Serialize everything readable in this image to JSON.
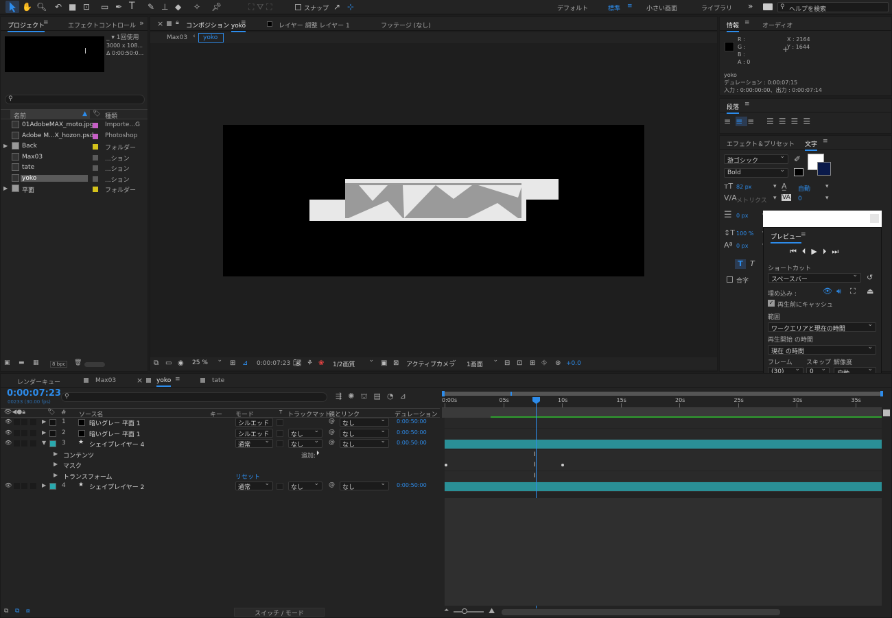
{
  "toolbar": {
    "snap_label": "スナップ",
    "workspaces": [
      "デフォルト",
      "標準",
      "小さい画面",
      "ライブラリ"
    ],
    "active_workspace": "標準",
    "search_placeholder": "ヘルプを検索"
  },
  "project": {
    "tab_project": "プロジェクト",
    "tab_effect_controls": "エフェクトコントロール",
    "thumb_info": [
      "1回使用",
      "3000 x 108...",
      "Δ 0:00:50:0..."
    ],
    "col_name": "名前",
    "col_type": "種類",
    "search_placeholder": "",
    "items": [
      {
        "name": "01AdobeMAX_moto.jpg",
        "type": "Importe...G",
        "color": "#c65fc6",
        "icon": "image-file-icon"
      },
      {
        "name": "Adobe M...X_hozon.psd",
        "type": "Photoshop",
        "color": "#c65fc6",
        "icon": "psd-file-icon"
      },
      {
        "name": "Back",
        "type": "フォルダー",
        "color": "#d4c21b",
        "icon": "folder-icon"
      },
      {
        "name": "Max03",
        "type": "...ション",
        "color": "#5a5a5a",
        "icon": "composition-icon"
      },
      {
        "name": "tate",
        "type": "...ション",
        "color": "#5a5a5a",
        "icon": "composition-icon"
      },
      {
        "name": "yoko",
        "type": "...ション",
        "color": "#5a5a5a",
        "icon": "composition-icon",
        "selected": true
      },
      {
        "name": "平面",
        "type": "フォルダー",
        "color": "#d4c21b",
        "icon": "folder-icon"
      }
    ],
    "bpc": "8 bpc"
  },
  "viewer": {
    "tab_comp_prefix": "コンポジション",
    "tab_comp_name": "yoko",
    "tab_layer": "レイヤー 調整 レイヤー 1",
    "tab_footage": "フッテージ (なし)",
    "breadcrumbs": [
      "Max03",
      "yoko"
    ],
    "zoom": "25 %",
    "timecode": "0:00:07:23",
    "resolution": "1/2画質",
    "camera": "アクティブカメラ",
    "views": "1画面",
    "exposure": "+0.0"
  },
  "info": {
    "tab_info": "情報",
    "tab_audio": "オーディオ",
    "rgba": [
      "R :",
      "G :",
      "B :",
      "A :  0"
    ],
    "x": "X : 2164",
    "y": "Y : 1644",
    "layer": "yoko",
    "duration": "デュレーション : 0:00:07:15",
    "inout": "入力 : 0:00:00:00、出力 : 0:00:07:14"
  },
  "paragraph": {
    "tab": "段落"
  },
  "character": {
    "tab_effects": "エフェクト＆プリセット",
    "tab_char": "文字",
    "font": "游ゴシック",
    "style": "Bold",
    "size": "82 px",
    "leading": "自動",
    "kerning": "メトリクス",
    "tracking": "0",
    "stroke": "0 px",
    "vscale": "100 %",
    "baseline": "0 px",
    "ligature": "合字"
  },
  "preview": {
    "title": "プレビュー",
    "shortcut_label": "ショートカット",
    "shortcut": "スペースバー",
    "embed_label": "埋め込み :",
    "cache_label": "再生前にキャッシュ",
    "range_label": "範囲",
    "range": "ワークエリアと現在の時間",
    "start_label": "再生開始 の時間",
    "start": "現在 の時間",
    "frame_label": "フレーム",
    "skip_label": "スキップ",
    "res_label": "解像度",
    "frame": "(30)",
    "skip": "0",
    "res": "自動"
  },
  "timeline": {
    "tabs": [
      "レンダーキュー",
      "Max03",
      "yoko",
      "tate"
    ],
    "active_tab": "yoko",
    "timecode": "0:00:07:23",
    "fps": "00233 (30.00 fps)",
    "cols": {
      "num": "#",
      "source": "ソース名",
      "key": "キー",
      "mode": "モード",
      "t": "T",
      "trkmat": "トラックマット",
      "parent": "親とリンク",
      "duration": "デュレーション"
    },
    "ruler": [
      "0:00s",
      "05s",
      "10s",
      "15s",
      "20s",
      "25s",
      "30s",
      "35s"
    ],
    "layers": [
      {
        "num": "1",
        "name": "暗いグレー 平面 1",
        "mode": "シルエット",
        "trkmat": "",
        "parent": "なし",
        "dur": "0:00:50:00",
        "color": "#111"
      },
      {
        "num": "2",
        "name": "暗いグレー 平面 1",
        "mode": "シルエット",
        "trkmat": "なし",
        "parent": "なし",
        "dur": "0:00:50:00",
        "color": "#111"
      },
      {
        "num": "3",
        "name": "シェイプレイヤー 4",
        "mode": "通常",
        "trkmat": "なし",
        "parent": "なし",
        "dur": "0:00:50:00",
        "color": "#2aa9ae"
      },
      {
        "num": "4",
        "name": "シェイプレイヤー 2",
        "mode": "通常",
        "trkmat": "なし",
        "parent": "なし",
        "dur": "0:00:50:00",
        "color": "#2aa9ae"
      }
    ],
    "sub": {
      "contents": "コンテンツ",
      "add": "追加:",
      "mask": "マスク",
      "transform": "トランスフォーム",
      "reset": "リセット"
    },
    "switch_mode": "スイッチ / モード"
  }
}
